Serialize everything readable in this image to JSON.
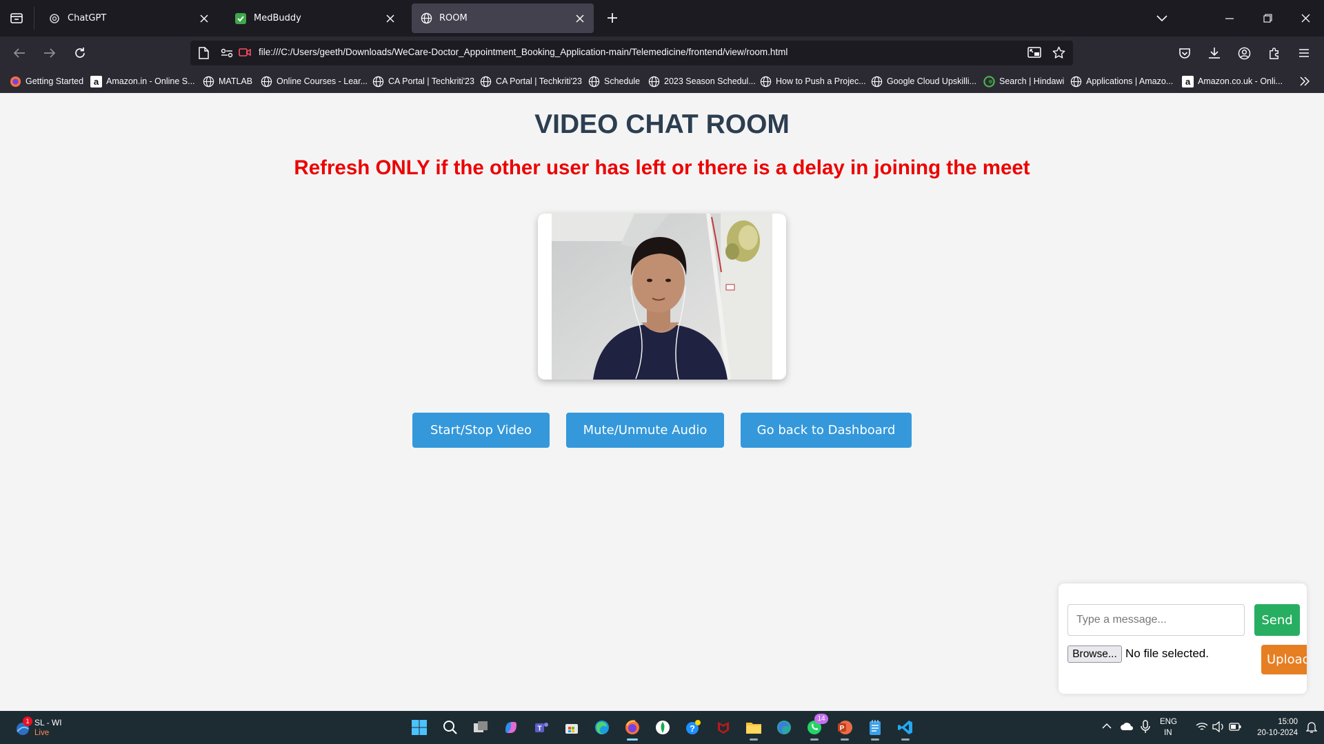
{
  "browser": {
    "tabs": [
      {
        "title": "ChatGPT",
        "icon": "chatgpt-icon",
        "active": false
      },
      {
        "title": "MedBuddy",
        "icon": "medbuddy-icon",
        "active": false
      },
      {
        "title": "ROOM",
        "icon": "globe-icon",
        "active": true
      }
    ],
    "url": "file:///C:/Users/geeth/Downloads/WeCare-Doctor_Appointment_Booking_Application-main/Telemedicine/frontend/view/room.html",
    "bookmarks": [
      {
        "label": "Getting Started",
        "icon": "firefox-icon"
      },
      {
        "label": "Amazon.in - Online S...",
        "icon": "amazon-icon"
      },
      {
        "label": "MATLAB",
        "icon": "globe-icon"
      },
      {
        "label": "Online Courses - Lear...",
        "icon": "globe-icon"
      },
      {
        "label": "CA Portal | Techkriti'23",
        "icon": "globe-icon"
      },
      {
        "label": "CA Portal | Techkriti'23",
        "icon": "globe-icon"
      },
      {
        "label": "Schedule",
        "icon": "globe-icon"
      },
      {
        "label": "2023 Season Schedul...",
        "icon": "globe-icon"
      },
      {
        "label": "How to Push a Projec...",
        "icon": "globe-icon"
      },
      {
        "label": "Google Cloud Upskilli...",
        "icon": "globe-icon"
      },
      {
        "label": "Search | Hindawi",
        "icon": "hindawi-icon"
      },
      {
        "label": "Applications | Amazo...",
        "icon": "globe-icon"
      },
      {
        "label": "Amazon.co.uk - Onli...",
        "icon": "amazon-icon"
      }
    ]
  },
  "page": {
    "title": "VIDEO CHAT ROOM",
    "warning": "Refresh ONLY if the other user has left or there is a delay in joining the meet",
    "buttons": {
      "video": "Start/Stop Video",
      "audio": "Mute/Unmute Audio",
      "dashboard": "Go back to Dashboard"
    },
    "chat": {
      "placeholder": "Type a message...",
      "send": "Send",
      "browse": "Browse...",
      "file_status": "No file selected.",
      "upload": "Upload"
    }
  },
  "taskbar": {
    "weather": {
      "title": "SL - WI",
      "status": "Live",
      "badge": "1"
    },
    "whatsapp_badge": "14",
    "tray": {
      "lang": "ENG",
      "region": "IN",
      "time": "15:00",
      "date": "20-10-2024"
    }
  },
  "colors": {
    "title": "#2c3e50",
    "warning": "#ec0000",
    "primary_button": "#3498db",
    "send_button": "#27ae60",
    "upload_button": "#e67e22"
  }
}
